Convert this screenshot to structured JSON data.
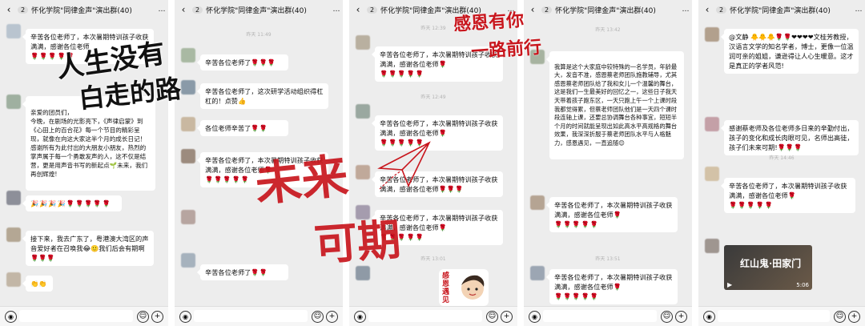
{
  "colors": {
    "bg": "#ededed",
    "bubble": "#ffffff",
    "flower": "#c62828",
    "calligraphy_red": "#c8161d"
  },
  "header": {
    "back": "‹",
    "unread": "2",
    "title": "怀化学院\"同律金声\"演出群(40)",
    "more": "…"
  },
  "p1": {
    "m1": "辛苦各位老师了，本次暑期特训孩子收获满满，感谢各位老师",
    "m1b": "🌹🌹🌹🌹🌹",
    "m2": "亲爱的团员们，\n今晚，在剧场的光影亮下，《声律启蒙》到《心田上的百合花》每一个节目的精彩呈现，就像在向这大家这半个月的成长日记！感谢所有为此付出的大朋友小朋友，热烈的掌声属于每一个勇敢发声的人，这不仅是结营，更是用声音书写的新起点🌱未来，我们再创辉煌!",
    "m3": "🎉🎉🎉🎉🌹🌹🌹🌹🌹",
    "m4": "接下来，我去广东了，粤港澳大湾区的声音爱好者在召唤我😂🙂我们后会有期啊🌹🌹🌹",
    "m5": "👏👏"
  },
  "p2": {
    "t1": "昨天 11:49",
    "m1": "辛苦各位老师了🌹🌹🌹",
    "m2": "辛苦各位老师了，这次研学活动组织得杠杠的！点赞👍",
    "m3": "各位老师辛苦了🌹🌹",
    "m4": "辛苦各位老师了，本次暑期特训孩子收获满满，感谢各位老师🌹",
    "m4b": "🌹🌹🌹🌹🌹",
    "m5": "辛苦各位老师了🌹🌹"
  },
  "p3": {
    "t1": "昨天 12:39",
    "m1": "辛苦各位老师了，本次暑期特训孩子收获满满，感谢各位老师🌹",
    "m1b": "🌹🌹🌹🌹🌹",
    "t2": "昨天 12:49",
    "m2": "辛苦各位老师了，本次暑期特训孩子收获满满，感谢各位老师🌹",
    "m2b": "🌹🌹🌹🌹🌹",
    "m3": "辛苦各位老师了，本次暑期特训孩子收获满满，感谢各位老师🌹🌹🌹",
    "m4": "辛苦各位老师了，本次暑期特训孩子收获满满，感谢各位老师🌹",
    "m4b": "🌹🌹🌹🌹🌹",
    "t3": "昨天 13:01",
    "sticker_text": "感恩遇见"
  },
  "p4": {
    "t1": "昨天 13:42",
    "m1": "我算是这个大家庭中较特殊的一名学员，年龄最大，发音不准，感恩蔡老师团队施教辅导，尤其感恩蔡老师团队给了我和女儿一个温馨的舞台，\n这是我们一生最美好的回忆之一，这些日子我天天带着孩子跑东区，一天只跑上午一个上课时段我都觉得累，但蔡老师团队他们是一天四个课时段连轴上课，还要总协调舞台各种事宜，短短半个月的时间就能呈现出如此高水平高规格的舞台效果，我深深折服于蔡老师团队水平与人格魅力，感恩遇见，一直追随😊",
    "m2": "辛苦各位老师了，本次暑期特训孩子收获满满，感谢各位老师🌹",
    "m2b": "🌹🌹🌹🌹🌹",
    "t2": "昨天 13:51",
    "m3": "辛苦各位老师了，本次暑期特训孩子收获满满，感谢各位老师🌹",
    "m3b": "🌹🌹🌹🌹🌹"
  },
  "p5": {
    "m1": "@文静 🐥🐥🐥🌹🌹❤❤❤❤文桂芳教授，汉语言文学的知名学者，博士，更像一位温润可亲的姐姐，谦逊得让人心生暖意。这才是真正的学者风范!",
    "m2": "感谢蔡老师及各位老师多日来的辛勤付出，孩子的变化和成长肉眼可见，名师出高徒，孩子们未来可期!🌹🌹🌹",
    "t1": "昨天 14:46",
    "m3": "辛苦各位老师了，本次暑期特训孩子收获满满，感谢各位老师🌹",
    "m3b": "🌹🌹🌹🌹🌹",
    "video_title": "红山鬼·田家门",
    "video_time": "5:06"
  },
  "overlay": {
    "black_line1": "人生没有",
    "black_line2": "白走的路",
    "red_mid1": "未来",
    "red_mid2": "可期",
    "red_top1": "感恩有你",
    "red_top2": "一路前行"
  }
}
